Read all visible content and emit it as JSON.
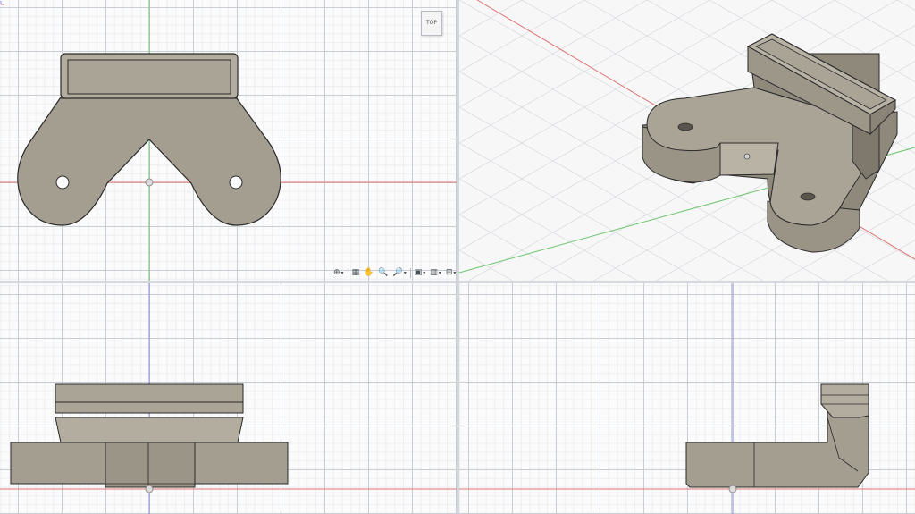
{
  "viewcube": {
    "label": "TOP"
  },
  "colors": {
    "body_fill": "#a49e90",
    "body_light": "#b7b1a4",
    "body_dark": "#8e887b",
    "edge": "#2a2a2a",
    "axis_x": "#e07474",
    "axis_y": "#6fc46f",
    "axis_z": "#8b8be0",
    "grid_major": "#c9ced4",
    "grid_minor": "#eceef1"
  },
  "navbar": {
    "items": [
      {
        "icon": "orbit-icon",
        "glyph": "⊕",
        "has_menu": true
      },
      {
        "icon": "look-at-icon",
        "glyph": "▦",
        "has_menu": false
      },
      {
        "icon": "pan-hand-icon",
        "glyph": "✋",
        "has_menu": false
      },
      {
        "icon": "zoom-icon",
        "glyph": "🔍",
        "has_menu": false
      },
      {
        "icon": "zoom-window-icon",
        "glyph": "🔎",
        "has_menu": true
      },
      {
        "icon": "display-settings-icon",
        "glyph": "▣",
        "has_menu": true
      },
      {
        "icon": "grid-snaps-icon",
        "glyph": "▥",
        "has_menu": true
      },
      {
        "icon": "viewports-icon",
        "glyph": "⊞",
        "has_menu": true
      }
    ]
  }
}
